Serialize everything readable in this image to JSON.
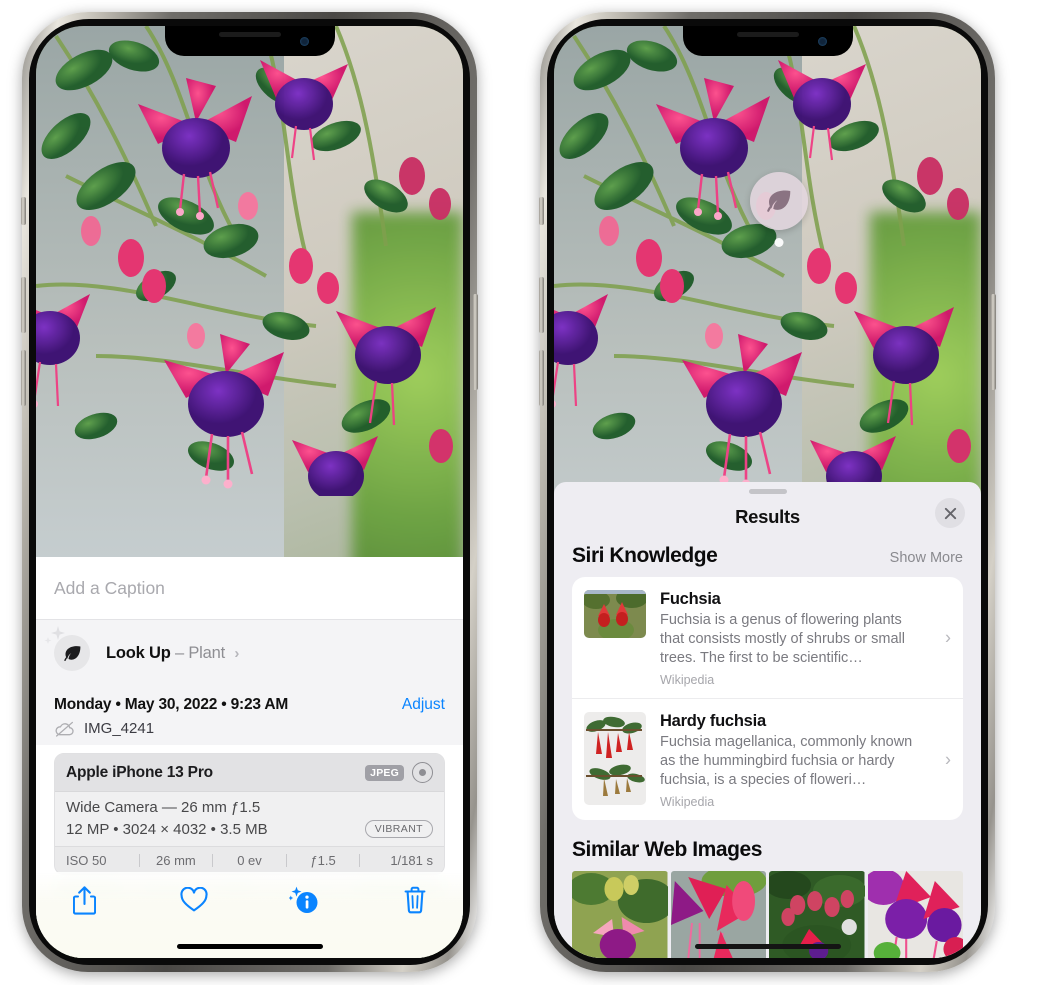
{
  "left_phone": {
    "caption": {
      "placeholder": "Add a Caption",
      "value": ""
    },
    "lookup": {
      "label": "Look Up",
      "dash": "–",
      "subject": "Plant",
      "chevron": "›",
      "icon": "leaf-icon"
    },
    "metadata": {
      "date_line": "Monday • May 30, 2022 • 9:23 AM",
      "adjust_label": "Adjust",
      "filename": "IMG_4241",
      "cloud_icon": "icloud-slash-icon"
    },
    "exif": {
      "device": "Apple iPhone 13 Pro",
      "format_tag": "JPEG",
      "raw_icon": "raw-aperture-icon",
      "lens_line": "Wide Camera — 26 mm ƒ1.5",
      "size_line": "12 MP • 3024 × 4032 • 3.5 MB",
      "style_tag": "VIBRANT",
      "stats": [
        "ISO 50",
        "26 mm",
        "0 ev",
        "ƒ1.5",
        "1/181 s"
      ]
    },
    "toolbar": {
      "items": [
        {
          "name": "share-button",
          "icon": "share-icon"
        },
        {
          "name": "favorite-button",
          "icon": "heart-icon"
        },
        {
          "name": "info-button",
          "icon": "info-sparkle-icon"
        },
        {
          "name": "delete-button",
          "icon": "trash-icon"
        }
      ],
      "accent_color": "#0a84ff"
    }
  },
  "right_phone": {
    "visual_badge": {
      "icon": "leaf-icon",
      "name": "visual-lookup-badge"
    },
    "sheet": {
      "title": "Results",
      "close_icon": "close-icon"
    },
    "siri_knowledge": {
      "title": "Siri Knowledge",
      "action": "Show More",
      "items": [
        {
          "name": "Fuchsia",
          "description": "Fuchsia is a genus of flowering plants that consists mostly of shrubs or small trees. The first to be scientific…",
          "source": "Wikipedia",
          "chevron": "›"
        },
        {
          "name": "Hardy fuchsia",
          "description": "Fuchsia magellanica, commonly known as the hummingbird fuchsia or hardy fuchsia, is a species of floweri…",
          "source": "Wikipedia",
          "chevron": "›"
        }
      ]
    },
    "similar_web_images": {
      "title": "Similar Web Images",
      "count": 4
    }
  },
  "colors": {
    "accent_blue": "#0a84ff",
    "sheet_bg": "#eeedf2",
    "card_bg": "#ffffff",
    "secondary_text": "#8e8e93"
  }
}
